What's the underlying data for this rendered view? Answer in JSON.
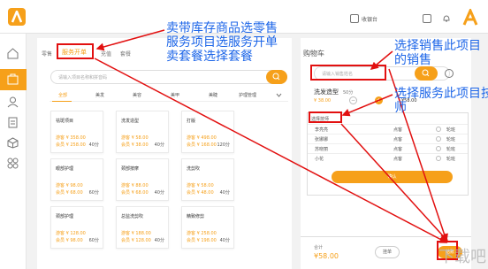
{
  "topbar": {
    "store": "收银台",
    "icons": [
      "logo-icon",
      "store-icon",
      "list-icon",
      "bell-icon"
    ]
  },
  "sidebar": {
    "icons": [
      "home-icon",
      "cash-register-icon",
      "person-icon",
      "document-icon",
      "box-icon",
      "grid-icon"
    ]
  },
  "main": {
    "tabs": [
      "零售",
      "服务开单",
      "充值",
      "套餐"
    ],
    "search_placeholder": "请输入项目名称和拼音码",
    "categories": [
      "全部",
      "美发",
      "美容",
      "美甲",
      "美睫",
      "护理管理"
    ],
    "items": [
      {
        "name": "祛斑项目",
        "price": "游客 ¥ 358.00",
        "member": "会员 ¥ 258.00",
        "dur": "40分"
      },
      {
        "name": "洗发造型",
        "price": "游客 ¥ 58.00",
        "member": "会员 ¥ 38.00",
        "dur": "40分"
      },
      {
        "name": "打版",
        "price": "游客 ¥ 498.00",
        "member": "会员 ¥ 168.00",
        "dur": "120分"
      },
      {
        "name": "眼部护理",
        "price": "游客 ¥ 98.00",
        "member": "会员 ¥ 68.00",
        "dur": "60分"
      },
      {
        "name": "颈部按摩",
        "price": "游客 ¥ 88.00",
        "member": "会员 ¥ 68.00",
        "dur": "40分"
      },
      {
        "name": "洗剪吹",
        "price": "游客 ¥ 58.00",
        "member": "会员 ¥ 48.00",
        "dur": "40分"
      },
      {
        "name": "颈部护理",
        "price": "游客 ¥ 128.00",
        "member": "会员 ¥ 98.00",
        "dur": "60分"
      },
      {
        "name": "总监洗剪吹",
        "price": "游客 ¥ 188.00",
        "member": "会员 ¥ 128.00",
        "dur": "40分"
      },
      {
        "name": "精致修剪",
        "price": "游客 ¥ 258.00",
        "member": "会员 ¥ 198.00",
        "dur": "40分"
      }
    ]
  },
  "cart": {
    "title": "购物车",
    "search_placeholder": "请输入销售姓名",
    "item_name": "洗发造型",
    "item_qty": "50分",
    "item_price": "¥ 38.00",
    "item_total": "¥58.00",
    "tech_header": "选择技师",
    "techs": [
      {
        "name": "李亮亮",
        "status": "点客",
        "role": "轮班"
      },
      {
        "name": "张娜娜",
        "status": "点客",
        "role": "轮班"
      },
      {
        "name": "苏晓丽",
        "status": "点客",
        "role": "轮班"
      },
      {
        "name": "小花",
        "status": "点客",
        "role": "轮班"
      }
    ],
    "confirm": "确认",
    "bottom_label": "合计",
    "total": "¥58.00",
    "clear": "挂单",
    "pay": "结账"
  },
  "annotations": {
    "top": [
      "卖带库存商品选零售",
      "服务项目选服务开单",
      "卖套餐选择套餐"
    ],
    "right1": [
      "选择销售此项目",
      "的销售"
    ],
    "right2": [
      "选择服务此项目技",
      "师"
    ]
  },
  "watermark": "下载吧",
  "colors": {
    "accent": "#f6a01a",
    "annotation": "#1d66e8",
    "arrow": "#e21010"
  }
}
